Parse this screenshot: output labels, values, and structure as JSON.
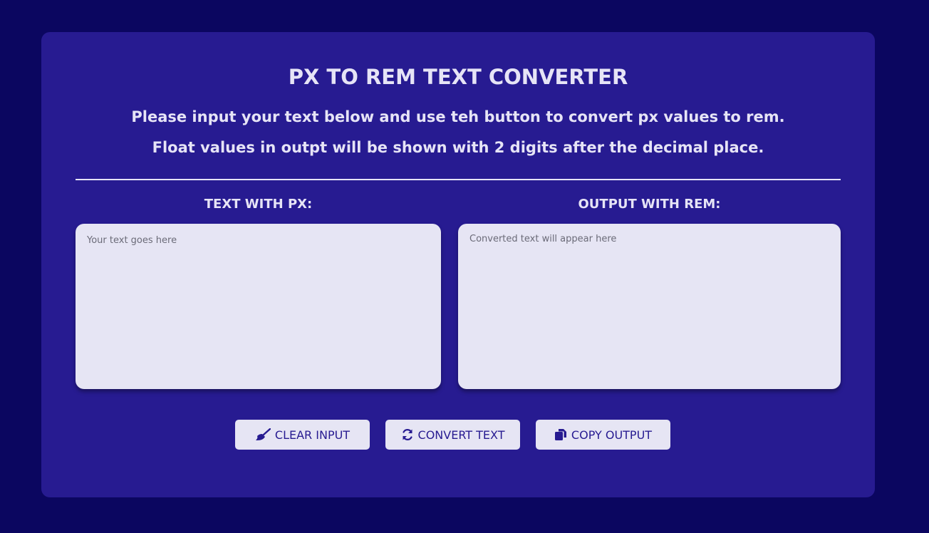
{
  "header": {
    "title": "PX TO REM TEXT CONVERTER",
    "subtitle": "Please input your text below and use teh button to convert px values to rem. Float values in outpt will be shown with 2 digits after the decimal place."
  },
  "input": {
    "label": "TEXT WITH PX:",
    "placeholder": "Your text goes here",
    "value": ""
  },
  "output": {
    "label": "OUTPUT WITH REM:",
    "placeholder": "Converted text will appear here",
    "value": ""
  },
  "buttons": {
    "clear": {
      "label": "CLEAR INPUT",
      "icon": "broom-icon"
    },
    "convert": {
      "label": "CONVERT TEXT",
      "icon": "sync-icon"
    },
    "copy": {
      "label": "COPY OUTPUT",
      "icon": "copy-icon"
    }
  },
  "colors": {
    "background": "#0b0660",
    "card": "#271b91",
    "text": "#e6e4f6",
    "field": "#e6e5f4",
    "button_text": "#271b91"
  }
}
